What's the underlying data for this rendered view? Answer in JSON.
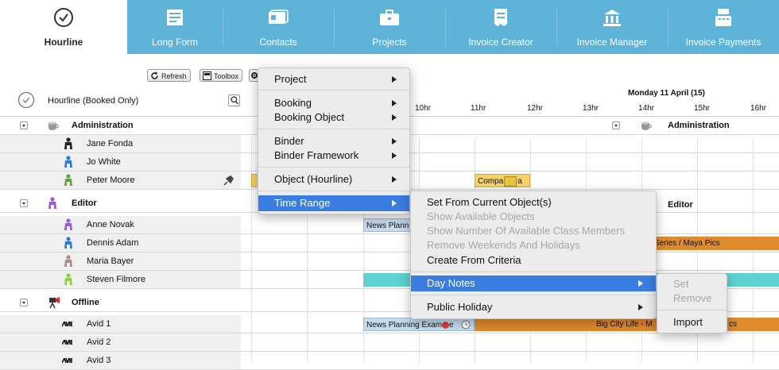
{
  "tabs": [
    {
      "label": "Hourline",
      "icon": "clock-icon"
    },
    {
      "label": "Long Form",
      "icon": "long-form-icon"
    },
    {
      "label": "Contacts",
      "icon": "contacts-card-icon"
    },
    {
      "label": "Projects",
      "icon": "briefcase-icon"
    },
    {
      "label": "Invoice Creator",
      "icon": "invoice-creator-icon"
    },
    {
      "label": "Invoice Manager",
      "icon": "bank-icon"
    },
    {
      "label": "Invoice Payments",
      "icon": "cash-register-icon"
    }
  ],
  "toolbar": {
    "refresh": "Refresh",
    "toolbox": "Toolbox"
  },
  "view": {
    "title": "Hourline (Booked Only)"
  },
  "timeline": {
    "date": "Monday 11 April (15)",
    "hours": [
      "10hr",
      "11hr",
      "12hr",
      "13hr",
      "14hr",
      "15hr",
      "16hr"
    ]
  },
  "groups": {
    "administration": "Administration",
    "editor": "Editor",
    "offline": "Offline"
  },
  "people": {
    "jane": "Jane Fonda",
    "jo": "Jo White",
    "peter": "Peter Moore",
    "anne": "Anne Novak",
    "dennis": "Dennis Adam",
    "maria": "Maria Bayer",
    "steven": "Steven Filmore",
    "avid1": "Avid 1",
    "avid2": "Avid 2",
    "avid3": "Avid 3"
  },
  "events": {
    "company": "Compa",
    "company_end": "a",
    "news1": "News Plann",
    "news2": "News Planning Exam",
    "news2_end": "e",
    "mini": "ini Series / Maya Pics",
    "bigcity": "Big City Life - M",
    "bigcity_end": "cs"
  },
  "menu1": [
    "Project",
    "Booking",
    "Booking Object",
    "Binder",
    "Binder Framework",
    "Object (Hourline)",
    "Time Range"
  ],
  "menu2": [
    "Set From Current Object(s)",
    "Show Available Objects",
    "Show Number Of Available Class Members",
    "Remove Weekends And Holidays",
    "Create From Criteria",
    "Day Notes",
    "Public Holiday"
  ],
  "menu3": [
    "Set",
    "Remove",
    "Import"
  ],
  "colors": {
    "tabbar": "#5eb3d9",
    "highlight": "#3a7de0",
    "orange": "#e08a2e",
    "cyan": "#5fd1d1",
    "event_blue": "#c5dcef",
    "event_yellow": "#f6d26a"
  }
}
